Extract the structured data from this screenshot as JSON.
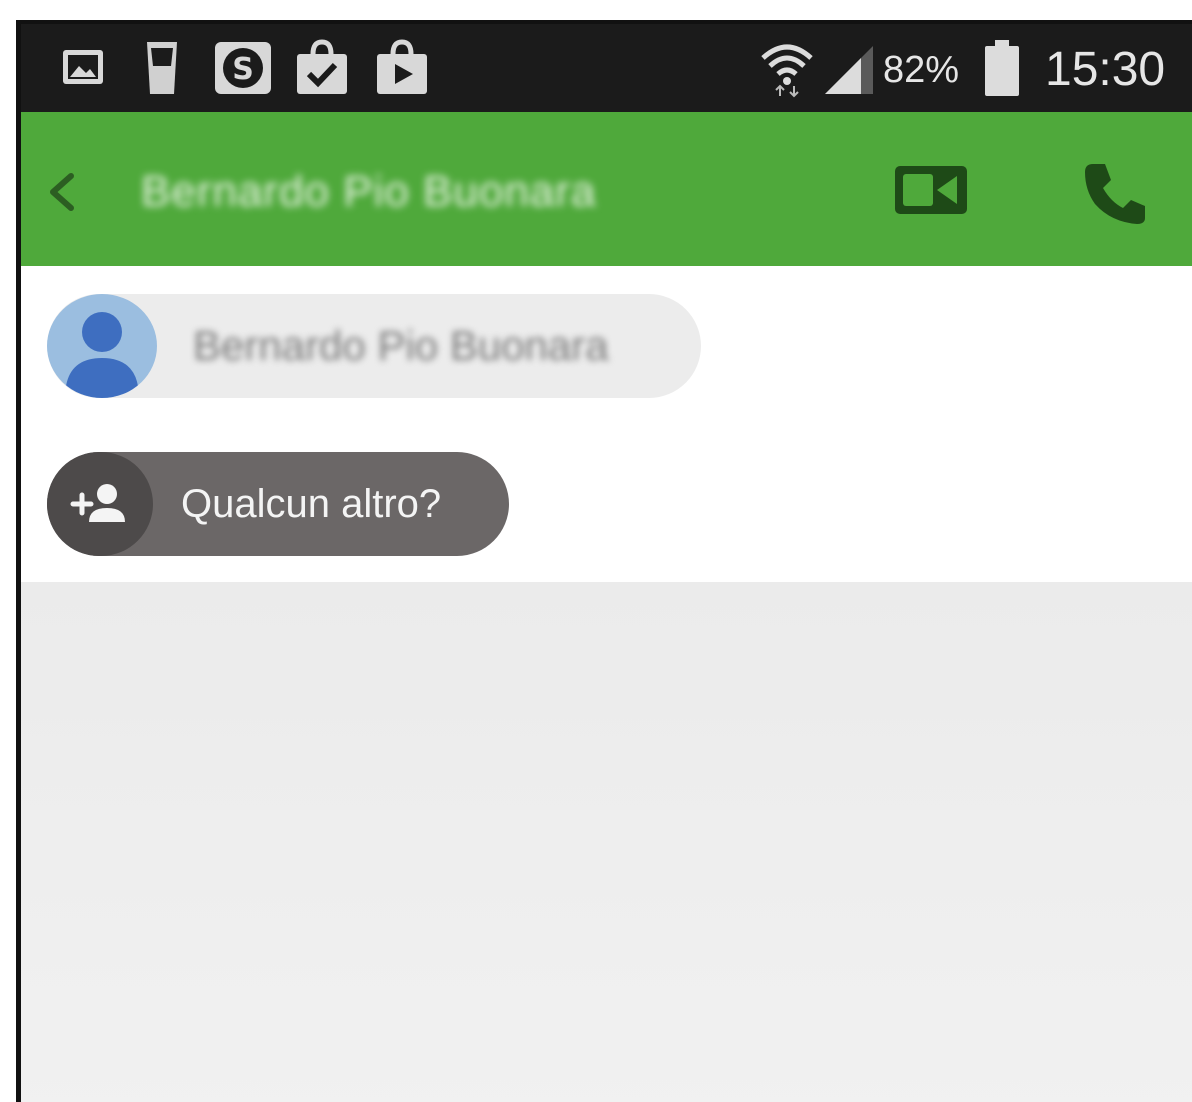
{
  "status_bar": {
    "battery_percent": "82%",
    "time": "15:30",
    "left_icons": [
      "gallery-icon",
      "glass-icon",
      "skype-icon",
      "shopping-bag-check-icon",
      "play-store-icon"
    ],
    "right_icons": [
      "wifi-icon",
      "signal-icon",
      "battery-icon"
    ]
  },
  "toolbar": {
    "title": "Bernardo Pio Buonara",
    "color": "#4fa93b",
    "icons": [
      "back-icon",
      "video-call-icon",
      "phone-icon"
    ]
  },
  "recipients": {
    "contact_name": "Bernardo Pio Buonara",
    "add_label": "Qualcun altro?"
  }
}
